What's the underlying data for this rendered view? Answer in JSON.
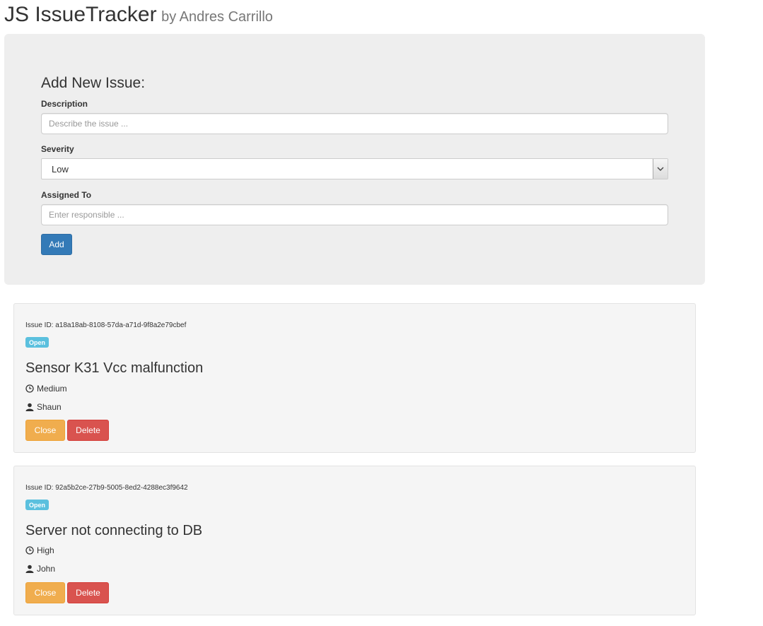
{
  "header": {
    "title": "JS IssueTracker",
    "byline": "by Andres Carrillo"
  },
  "form": {
    "heading": "Add New Issue:",
    "description_label": "Description",
    "description_placeholder": "Describe the issue ...",
    "severity_label": "Severity",
    "severity_value": "Low",
    "assigned_label": "Assigned To",
    "assigned_placeholder": "Enter responsible ...",
    "add_button": "Add"
  },
  "issues": [
    {
      "id_text": "Issue ID: a18a18ab-8108-57da-a71d-9f8a2e79cbef",
      "status": "Open",
      "description": "Sensor K31 Vcc malfunction",
      "severity": "Medium",
      "assigned_to": "Shaun",
      "close_label": "Close",
      "delete_label": "Delete"
    },
    {
      "id_text": "Issue ID: 92a5b2ce-27b9-5005-8ed2-4288ec3f9642",
      "status": "Open",
      "description": "Server not connecting to DB",
      "severity": "High",
      "assigned_to": "John",
      "close_label": "Close",
      "delete_label": "Delete"
    }
  ],
  "icons": {
    "severity": "clock-icon",
    "assignee": "user-icon",
    "select_arrow": "chevron-down-icon"
  },
  "colors": {
    "primary": "#337ab7",
    "warning": "#f0ad4e",
    "danger": "#d9534f",
    "info": "#5bc0de"
  }
}
